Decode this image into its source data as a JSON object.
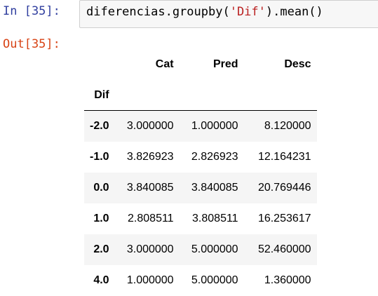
{
  "input_cell": {
    "prompt": "In [35]:",
    "code_pre": "diferencias.groupby(",
    "code_str": "'Dif'",
    "code_post": ").mean()"
  },
  "output_cell": {
    "prompt": "Out[35]:"
  },
  "dataframe": {
    "index_name": "Dif",
    "columns": [
      "Cat",
      "Pred",
      "Desc"
    ],
    "rows": [
      {
        "index": "-2.0",
        "values": [
          "3.000000",
          "1.000000",
          "8.120000"
        ]
      },
      {
        "index": "-1.0",
        "values": [
          "3.826923",
          "2.826923",
          "12.164231"
        ]
      },
      {
        "index": "0.0",
        "values": [
          "3.840085",
          "3.840085",
          "20.769446"
        ]
      },
      {
        "index": "1.0",
        "values": [
          "2.808511",
          "3.808511",
          "16.253617"
        ]
      },
      {
        "index": "2.0",
        "values": [
          "3.000000",
          "5.000000",
          "52.460000"
        ]
      },
      {
        "index": "4.0",
        "values": [
          "1.000000",
          "5.000000",
          "1.360000"
        ]
      }
    ]
  }
}
